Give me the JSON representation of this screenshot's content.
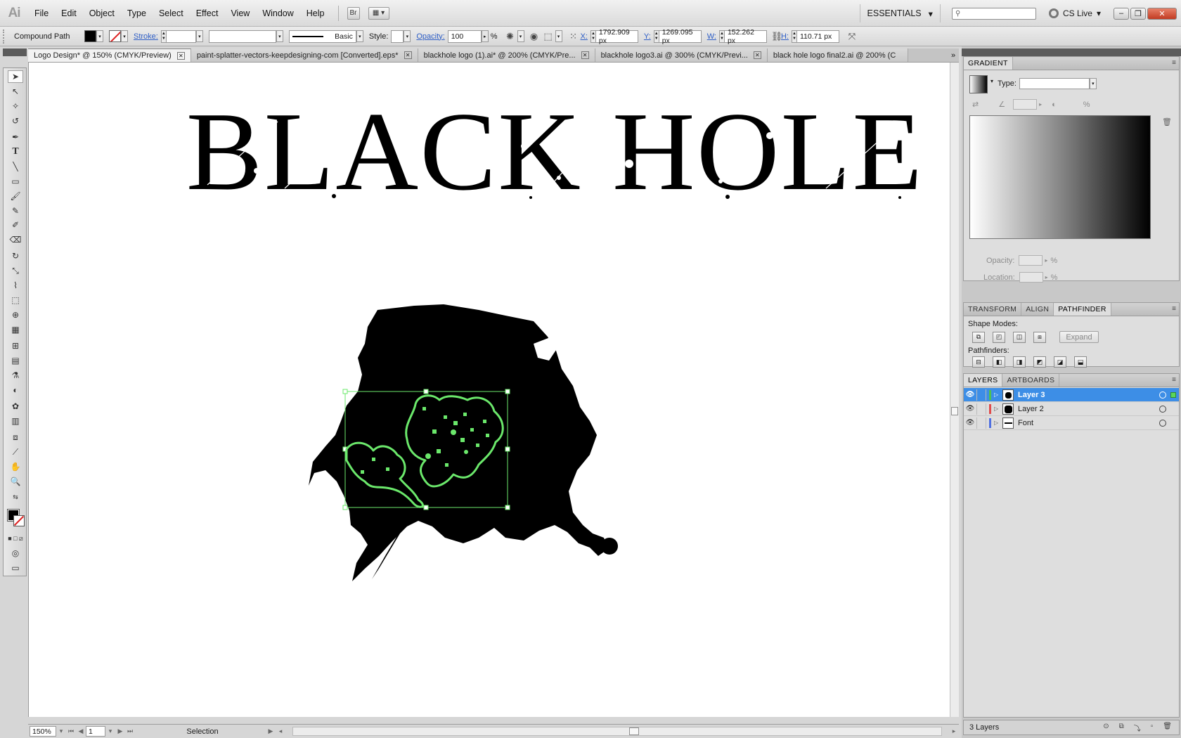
{
  "app": {
    "logo": "Ai"
  },
  "menu": [
    "File",
    "Edit",
    "Object",
    "Type",
    "Select",
    "Effect",
    "View",
    "Window",
    "Help"
  ],
  "menubar_buttons": {
    "bridge": "Br"
  },
  "workspace": {
    "label": "ESSENTIALS"
  },
  "search": {
    "placeholder": ""
  },
  "cslive": {
    "label": "CS Live"
  },
  "control": {
    "selection_type": "Compound Path",
    "stroke_label": "Stroke:",
    "brush_label": "Basic",
    "style_label": "Style:",
    "opacity_label": "Opacity:",
    "opacity_value": "100",
    "opacity_unit": "%",
    "x_label": "X:",
    "x_value": "1792.909 px",
    "y_label": "Y:",
    "y_value": "1269.095 px",
    "w_label": "W:",
    "w_value": "152.262 px",
    "h_label": "H:",
    "h_value": "110.71 px"
  },
  "tabs": [
    {
      "label": "Logo Design* @ 150% (CMYK/Preview)"
    },
    {
      "label": "paint-splatter-vectors-keepdesigning-com [Converted].eps*"
    },
    {
      "label": "blackhole logo (1).ai* @ 200% (CMYK/Pre..."
    },
    {
      "label": "blackhole logo3.ai @ 300% (CMYK/Previ..."
    },
    {
      "label": "black hole logo final2.ai @ 200% (C"
    }
  ],
  "artwork": {
    "title": "BLACK HOLE"
  },
  "statusbar": {
    "zoom": "150%",
    "artboard": "1",
    "status": "Selection"
  },
  "gradient_panel": {
    "tab": "GRADIENT",
    "type_label": "Type:",
    "percent": "%",
    "opacity_label": "Opacity:",
    "location_label": "Location:"
  },
  "pathfinder_panel": {
    "tabs": [
      "TRANSFORM",
      "ALIGN",
      "PATHFINDER"
    ],
    "shape_modes_label": "Shape Modes:",
    "expand_label": "Expand",
    "pathfinders_label": "Pathfinders:"
  },
  "layers_panel": {
    "tabs": [
      "LAYERS",
      "ARTBOARDS"
    ],
    "layers": [
      {
        "name": "Layer 3",
        "color": "#4fc24f",
        "selected": true
      },
      {
        "name": "Layer 2",
        "color": "#e04b4b",
        "selected": false
      },
      {
        "name": "Font",
        "color": "#4f6fe0",
        "selected": false
      }
    ],
    "footer": "3 Layers"
  },
  "colors": {
    "selection_accent": "#3d8ee6",
    "path_highlight": "#6be86b",
    "canvas": "#ffffff"
  }
}
